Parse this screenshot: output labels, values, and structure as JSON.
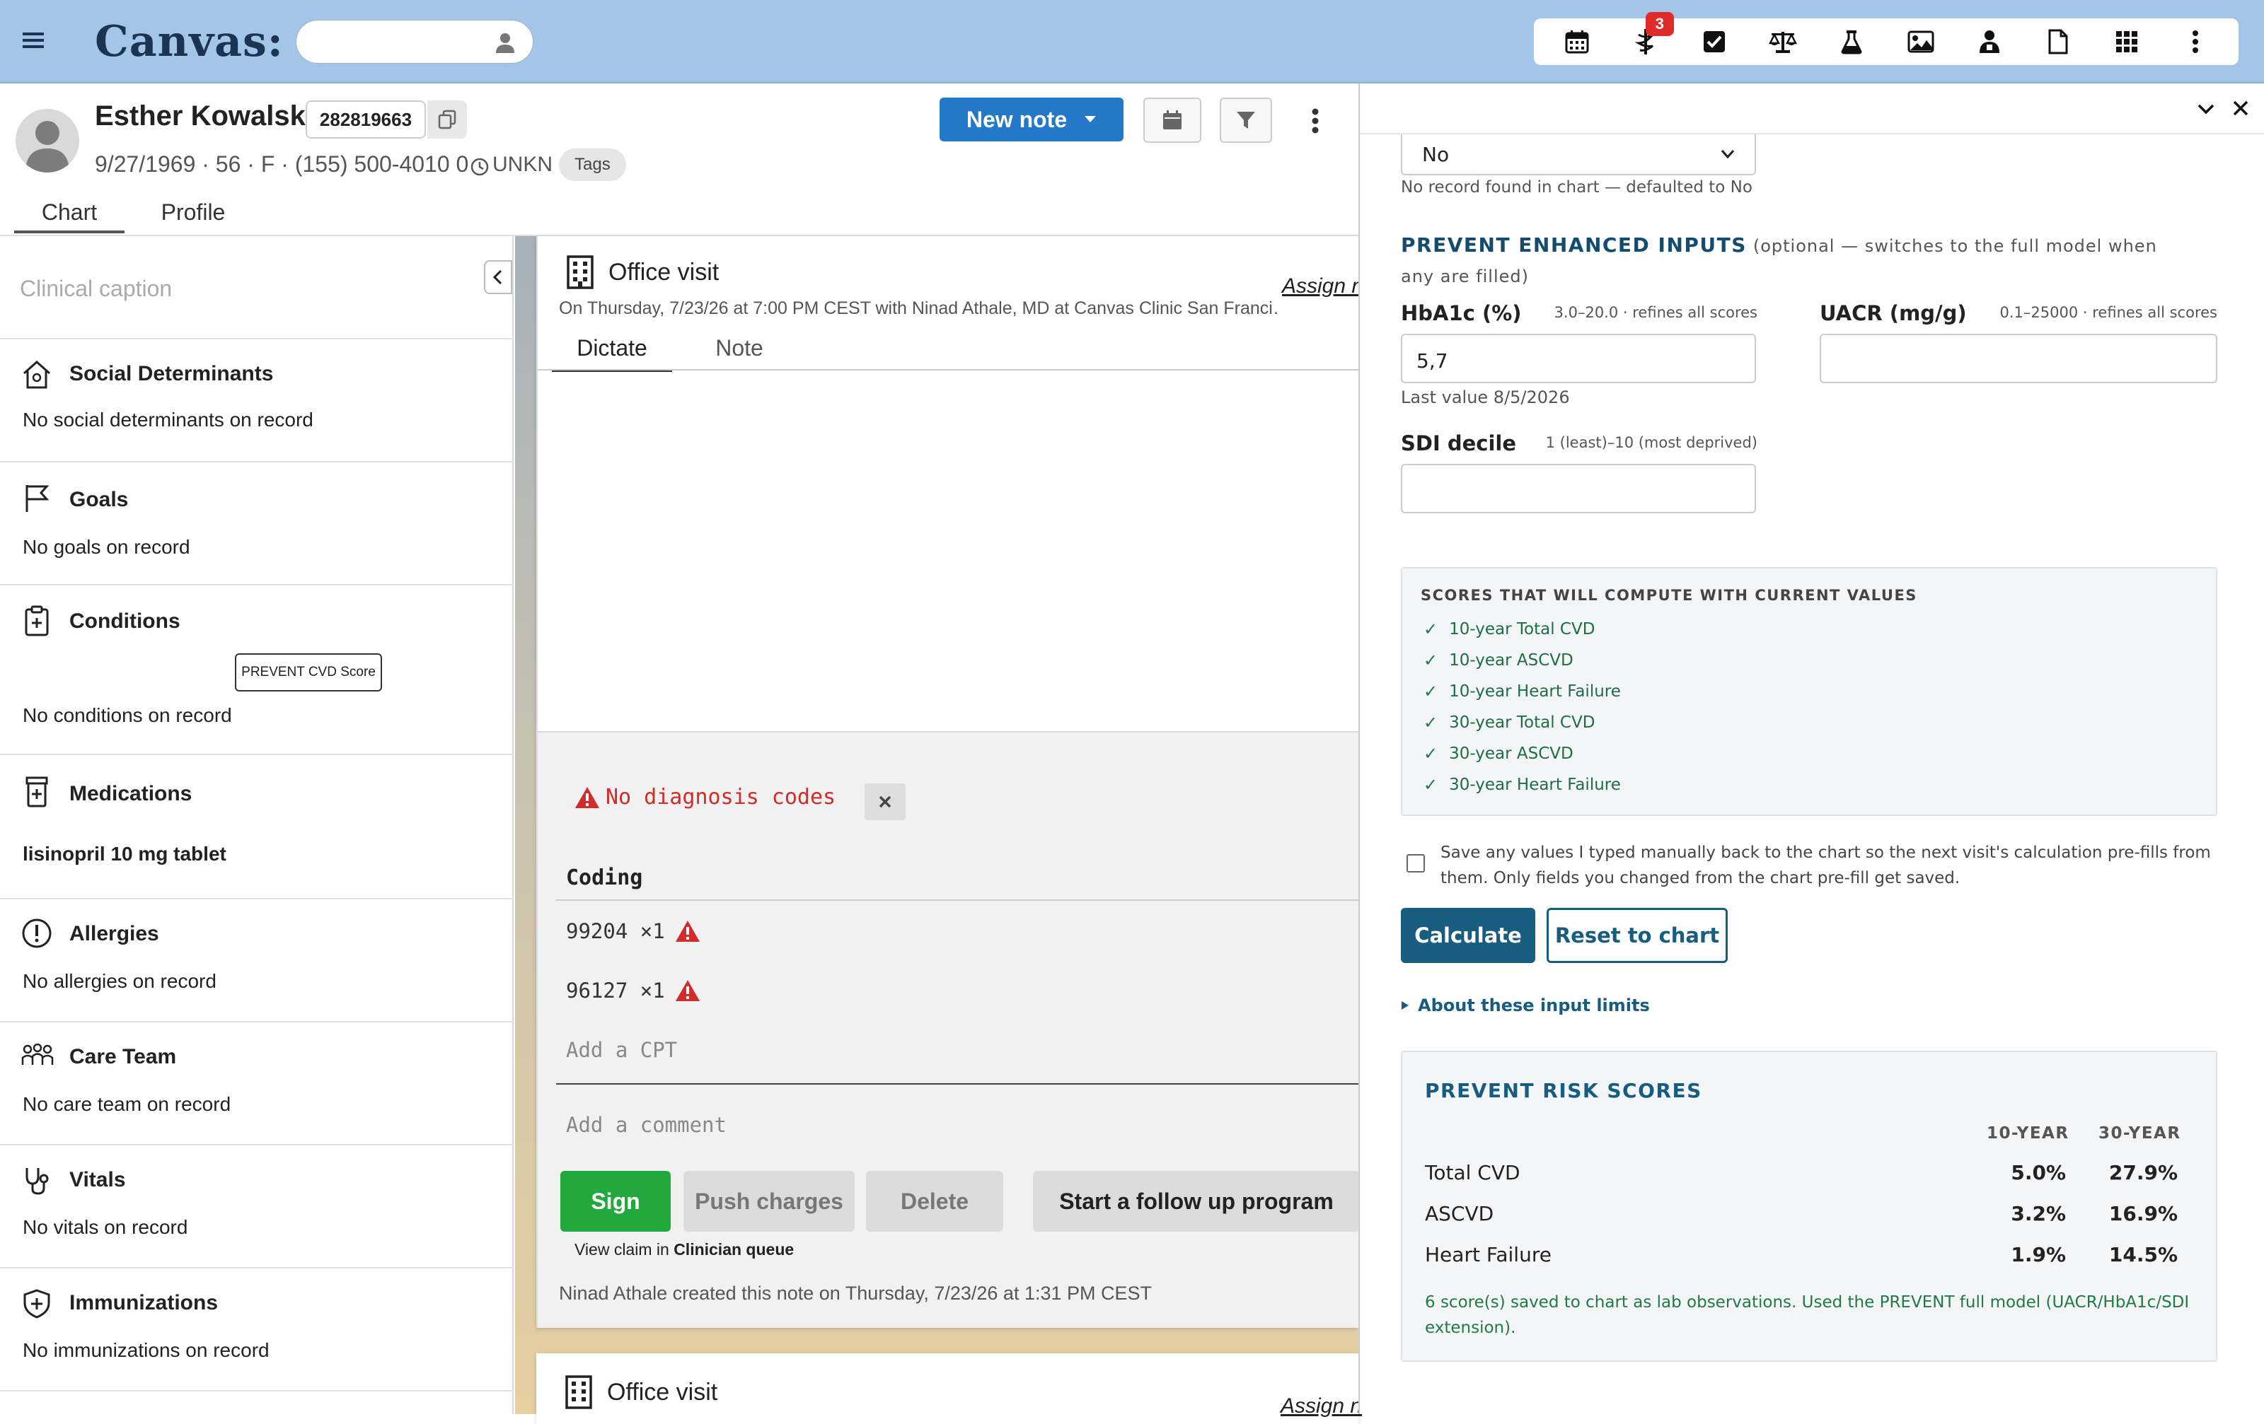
{
  "topbar": {
    "logo": "Canvas:",
    "search_placeholder": "",
    "notification_count": "3",
    "icons": [
      "calendar-icon",
      "caduceus-icon",
      "checkbox-icon",
      "scales-icon",
      "flask-icon",
      "image-icon",
      "provider-icon",
      "document-icon",
      "apps-grid-icon",
      "more-vertical-icon"
    ]
  },
  "patient": {
    "name": "Esther Kowalski",
    "mrn": "282819663",
    "demographics": "9/27/1969 · 56 · F · (155) 500-4010 0",
    "timezone": "UNKN",
    "tags_label": "Tags",
    "tabs": [
      "Chart",
      "Profile"
    ]
  },
  "toolbar": {
    "new_note_label": "New note"
  },
  "sidebar": {
    "caption_placeholder": "Clinical caption",
    "prevent_chip": "PREVENT CVD Score",
    "sections": [
      {
        "title": "Social Determinants",
        "body": "No social determinants on record",
        "icon": "house-icon"
      },
      {
        "title": "Goals",
        "body": "No goals on record",
        "icon": "flag-icon"
      },
      {
        "title": "Conditions",
        "body": "No conditions on record",
        "icon": "clipboard-plus-icon"
      },
      {
        "title": "Medications",
        "body": "lisinopril 10 mg tablet",
        "icon": "pill-bottle-icon"
      },
      {
        "title": "Allergies",
        "body": "No allergies on record",
        "icon": "alert-circle-icon"
      },
      {
        "title": "Care Team",
        "body": "No care team on record",
        "icon": "people-icon"
      },
      {
        "title": "Vitals",
        "body": "No vitals on record",
        "icon": "stethoscope-icon"
      },
      {
        "title": "Immunizations",
        "body": "No immunizations on record",
        "icon": "shield-plus-icon"
      }
    ]
  },
  "note": {
    "title": "Office visit",
    "assign_label": "Assign n",
    "meta": "On Thursday, 7/23/26 at 7:00 PM CEST with Ninad Athale, MD at Canvas Clinic San Franci…",
    "tabs": [
      "Dictate",
      "Note"
    ],
    "no_dx": "No diagnosis codes",
    "coding_title": "Coding",
    "cpt_codes": [
      "99204 ×1",
      "96127 ×1"
    ],
    "add_cpt_placeholder": "Add a CPT",
    "add_comment_placeholder": "Add a comment",
    "buttons": {
      "sign": "Sign",
      "push": "Push charges",
      "delete": "Delete",
      "followup": "Start a follow up program"
    },
    "view_claim_prefix": "View claim in",
    "view_claim_link": "Clinician queue",
    "created_by": "Ninad Athale created this note on Thursday, 7/23/26 at 1:31 PM CEST"
  },
  "note2": {
    "title": "Office visit",
    "assign_label": "Assign n"
  },
  "prevent_panel": {
    "select_value": "No",
    "select_note": "No record found in chart — defaulted to No",
    "enhanced_title": "PREVENT ENHANCED INPUTS",
    "enhanced_subtitle": "(optional — switches to the full model when any are filled)",
    "hba1c": {
      "label": "HbA1c (%)",
      "hint": "3.0–20.0 · refines all scores",
      "value": "5,7",
      "last_value": "Last value 8/5/2026"
    },
    "uacr": {
      "label": "UACR (mg/g)",
      "hint": "0.1–25000 · refines all scores",
      "value": ""
    },
    "sdi": {
      "label": "SDI decile",
      "hint": "1 (least)–10 (most deprived)",
      "value": ""
    },
    "scores_title": "SCORES THAT WILL COMPUTE WITH CURRENT VALUES",
    "scores": [
      "10-year Total CVD",
      "10-year ASCVD",
      "10-year Heart Failure",
      "30-year Total CVD",
      "30-year ASCVD",
      "30-year Heart Failure"
    ],
    "save_text": "Save any values I typed manually back to the chart so the next visit's calculation pre-fills from them. Only fields you changed from the chart pre-fill get saved.",
    "calculate_label": "Calculate",
    "reset_label": "Reset to chart",
    "about_label": "About these input limits",
    "risk": {
      "title": "PREVENT RISK SCORES",
      "col_10": "10-YEAR",
      "col_30": "30-YEAR",
      "rows": [
        {
          "label": "Total CVD",
          "ten": "5.0%",
          "thirty": "27.9%"
        },
        {
          "label": "ASCVD",
          "ten": "3.2%",
          "thirty": "16.9%"
        },
        {
          "label": "Heart Failure",
          "ten": "1.9%",
          "thirty": "14.5%"
        }
      ],
      "note": "6 score(s) saved to chart as lab observations. Used the PREVENT full model (UACR/HbA1c/SDI extension)."
    }
  },
  "colors": {
    "topbar": "#a3c5e7",
    "primary_button": "#2378c7",
    "sign_button": "#23a83e",
    "teal_accent": "#175d80",
    "error_red": "#d02c2c",
    "success_green": "#1f7a45"
  }
}
